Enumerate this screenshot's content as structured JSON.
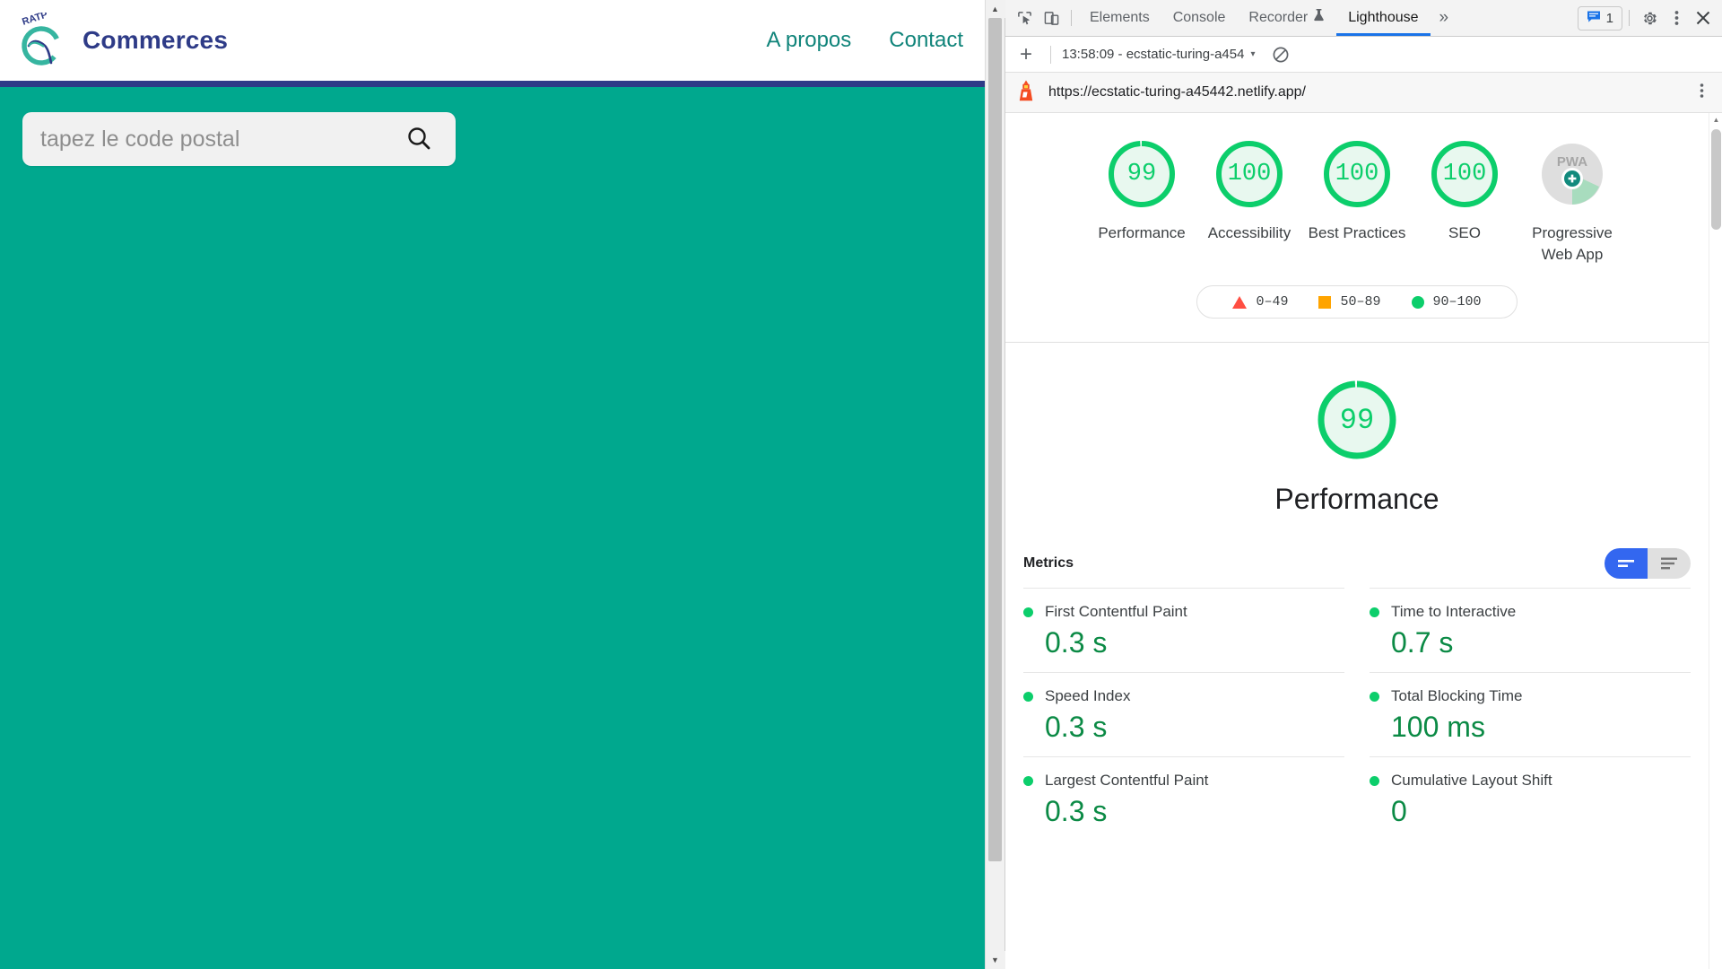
{
  "webpage": {
    "brand": {
      "logo_icon": "ratp-logo-icon",
      "name": "Commerces"
    },
    "nav": [
      {
        "label": "A propos"
      },
      {
        "label": "Contact"
      }
    ],
    "search": {
      "placeholder": "tapez le code postal",
      "value": "",
      "button_icon": "search-icon"
    },
    "colors": {
      "background": "#00a88e",
      "brand_text": "#2e3b87",
      "nav_link": "#10847a",
      "rule": "#2e3b87"
    }
  },
  "devtools": {
    "toolbar": {
      "inspect_icon": "inspect-element-icon",
      "device_icon": "device-toolbar-icon",
      "tabs": [
        {
          "label": "Elements",
          "active": false
        },
        {
          "label": "Console",
          "active": false
        },
        {
          "label": "Recorder",
          "active": false,
          "icon": "flask-icon"
        },
        {
          "label": "Lighthouse",
          "active": true
        }
      ],
      "overflow_label": "»",
      "issues_badge": {
        "icon": "message-icon",
        "count": "1"
      },
      "settings_icon": "gear-icon",
      "more_icon": "kebab-menu-icon",
      "close_icon": "close-icon"
    },
    "subbar": {
      "add_icon": "plus-icon",
      "run_label": "13:58:09 - ecstatic-turing-a454",
      "caret": "▾",
      "clear_icon": "clear-report-icon"
    },
    "urlbar": {
      "lighthouse_icon": "lighthouse-icon",
      "url": "https://ecstatic-turing-a45442.netlify.app/",
      "menu_icon": "kebab-menu-icon"
    },
    "scores": [
      {
        "value": "99",
        "label": "Performance",
        "color": "#0cce6b"
      },
      {
        "value": "100",
        "label": "Accessibility",
        "color": "#0cce6b"
      },
      {
        "value": "100",
        "label": "Best Practices",
        "color": "#0cce6b"
      },
      {
        "value": "100",
        "label": "SEO",
        "color": "#0cce6b"
      },
      {
        "value": "",
        "label": "Progressive Web App",
        "icon": "pwa-badge-icon"
      }
    ],
    "legend": [
      {
        "shape": "triangle",
        "text": "0–49",
        "color": "#ff4e42"
      },
      {
        "shape": "square",
        "text": "50–89",
        "color": "#ffa400"
      },
      {
        "shape": "circle",
        "text": "90–100",
        "color": "#0cce6b"
      }
    ],
    "performance_section": {
      "score": "99",
      "label": "Performance",
      "metrics_title": "Metrics",
      "toggle": {
        "active_icon": "collapsed-view-icon",
        "inactive_icon": "expanded-view-icon"
      },
      "metrics": [
        {
          "name": "First Contentful Paint",
          "value": "0.3 s",
          "status": "pass"
        },
        {
          "name": "Time to Interactive",
          "value": "0.7 s",
          "status": "pass"
        },
        {
          "name": "Speed Index",
          "value": "0.3 s",
          "status": "pass"
        },
        {
          "name": "Total Blocking Time",
          "value": "100 ms",
          "status": "pass"
        },
        {
          "name": "Largest Contentful Paint",
          "value": "0.3 s",
          "status": "pass"
        },
        {
          "name": "Cumulative Layout Shift",
          "value": "0",
          "status": "pass"
        }
      ]
    }
  }
}
